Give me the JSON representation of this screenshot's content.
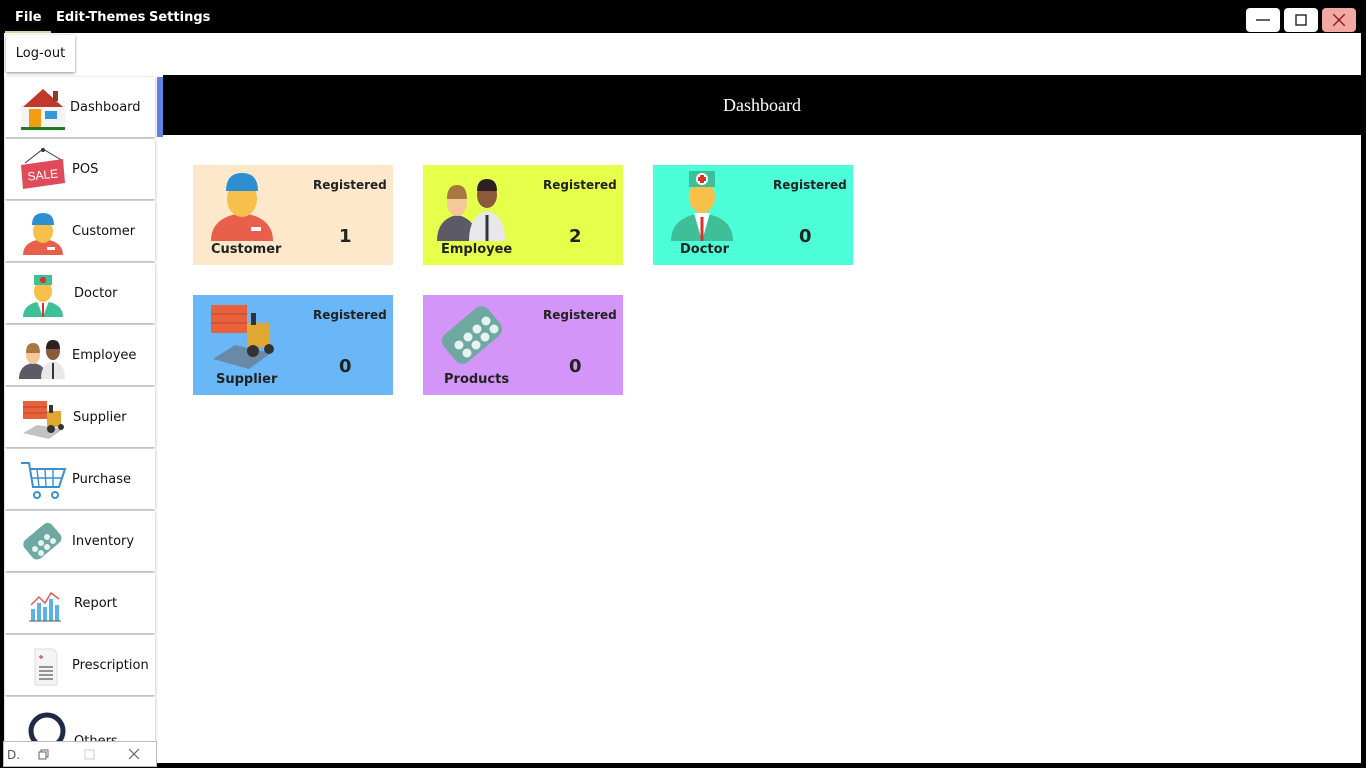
{
  "menu": {
    "file": "File",
    "themes": "Edit-Themes",
    "settings": "Settings"
  },
  "logout": "Log-out",
  "sidebar": {
    "items": [
      {
        "label": "Dashboard",
        "icon": "house-icon"
      },
      {
        "label": "POS",
        "icon": "sale-tag-icon"
      },
      {
        "label": "Customer",
        "icon": "customer-icon"
      },
      {
        "label": "Doctor",
        "icon": "doctor-icon"
      },
      {
        "label": "Employee",
        "icon": "employee-icon"
      },
      {
        "label": "Supplier",
        "icon": "forklift-icon"
      },
      {
        "label": "Purchase",
        "icon": "cart-icon"
      },
      {
        "label": "Inventory",
        "icon": "pills-icon"
      },
      {
        "label": "Report",
        "icon": "chart-icon"
      },
      {
        "label": "Prescription",
        "icon": "prescription-icon"
      },
      {
        "label": "Others",
        "icon": "others-icon"
      }
    ]
  },
  "header": {
    "title": "Dashboard"
  },
  "cards": [
    {
      "name": "Customer",
      "reg": "Registered",
      "count": "1",
      "bg": "#fde8cc"
    },
    {
      "name": "Employee",
      "reg": "Registered",
      "count": "2",
      "bg": "#e6ff4b"
    },
    {
      "name": "Doctor",
      "reg": "Registered",
      "count": "0",
      "bg": "#4dffd8"
    },
    {
      "name": "Supplier",
      "reg": "Registered",
      "count": "0",
      "bg": "#6ab7f7"
    },
    {
      "name": "Products",
      "reg": "Registered",
      "count": "0",
      "bg": "#d395f7"
    }
  ],
  "minimized": {
    "label": "D."
  }
}
